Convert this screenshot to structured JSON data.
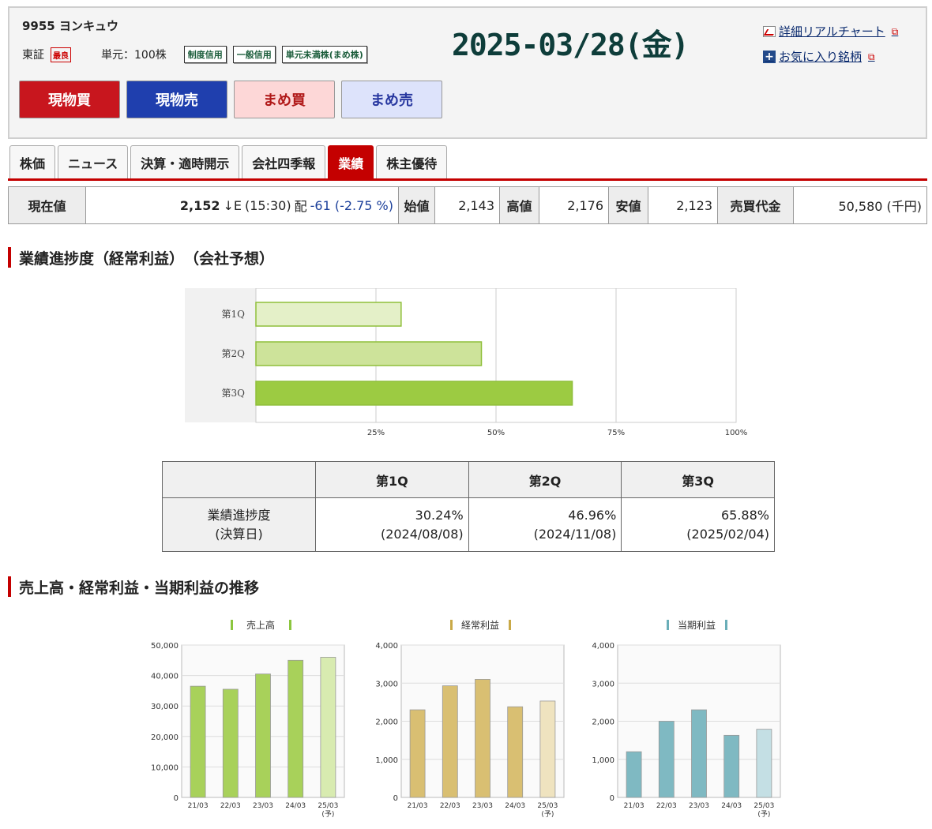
{
  "header": {
    "code_name": "9955 ヨンキュウ",
    "market": "東証",
    "market_tag": "最良",
    "unit": "単元：100株",
    "tags": [
      "制度信用",
      "一般信用",
      "単元未満株(まめ株)"
    ],
    "date": "2025-03/28(金)",
    "links": [
      "詳細リアルチャート",
      "お気に入り銘柄"
    ]
  },
  "buttons": [
    "現物買",
    "現物売",
    "まめ買",
    "まめ売"
  ],
  "tabs": [
    "株価",
    "ニュース",
    "決算・適時開示",
    "会社四季報",
    "業績",
    "株主優待"
  ],
  "active_tab": "業績",
  "price": {
    "current_label": "現在値",
    "current_value": "2,152",
    "arrow": "↓E",
    "time": "(15:30)",
    "dividend_note": "配",
    "change": "-61 (-2.75 %)",
    "open_label": "始値",
    "open": "2,143",
    "high_label": "高値",
    "high": "2,176",
    "low_label": "安値",
    "low": "2,123",
    "volume_label": "売買代金",
    "volume": "50,580 (千円)"
  },
  "section1_title": "業績進捗度（経常利益）　（会社予想）",
  "section2_title": "売上高・経常利益・当期利益の推移",
  "progress_table": {
    "headers": [
      "第1Q",
      "第2Q",
      "第3Q"
    ],
    "row_label_1": "業績進捗度",
    "row_label_2": "(決算日)",
    "values": [
      "30.24%",
      "46.96%",
      "65.88%"
    ],
    "dates": [
      "(2024/08/08)",
      "(2024/11/08)",
      "(2025/02/04)"
    ]
  },
  "chart_data": [
    {
      "type": "bar",
      "orientation": "horizontal",
      "categories": [
        "第1Q",
        "第2Q",
        "第3Q"
      ],
      "values": [
        30.24,
        46.96,
        65.88
      ],
      "xticks": [
        "25%",
        "50%",
        "75%",
        "100%"
      ],
      "xlim": [
        0,
        100
      ],
      "colors": [
        "#e4f0c8",
        "#cde39a",
        "#9ccb42"
      ]
    },
    {
      "type": "bar",
      "title": "売上高",
      "categories": [
        "21/03",
        "22/03",
        "23/03",
        "24/03",
        "25/03"
      ],
      "forecast_label": "(予)",
      "values": [
        36500,
        35500,
        40500,
        45000,
        46000
      ],
      "ylim": [
        0,
        50000
      ],
      "yticks": [
        "0",
        "10,000",
        "20,000",
        "30,000",
        "40,000",
        "50,000"
      ],
      "color": "#a8d15a",
      "forecast_color": "#d8ebb0",
      "title_mark_color": "#8cc63f"
    },
    {
      "type": "bar",
      "title": "経常利益",
      "categories": [
        "21/03",
        "22/03",
        "23/03",
        "24/03",
        "25/03"
      ],
      "forecast_label": "(予)",
      "values": [
        2300,
        2930,
        3100,
        2380,
        2530
      ],
      "ylim": [
        0,
        4000
      ],
      "yticks": [
        "0",
        "1,000",
        "2,000",
        "3,000",
        "4,000"
      ],
      "color": "#d9bf72",
      "forecast_color": "#efe3bf",
      "title_mark_color": "#c9a947"
    },
    {
      "type": "bar",
      "title": "当期利益",
      "categories": [
        "21/03",
        "22/03",
        "23/03",
        "24/03",
        "25/03"
      ],
      "forecast_label": "(予)",
      "values": [
        1200,
        2000,
        2300,
        1630,
        1790
      ],
      "ylim": [
        0,
        4000
      ],
      "yticks": [
        "0",
        "1,000",
        "2,000",
        "3,000",
        "4,000"
      ],
      "color": "#7fb9c2",
      "forecast_color": "#c4dfe4",
      "title_mark_color": "#6aaeb8"
    }
  ]
}
